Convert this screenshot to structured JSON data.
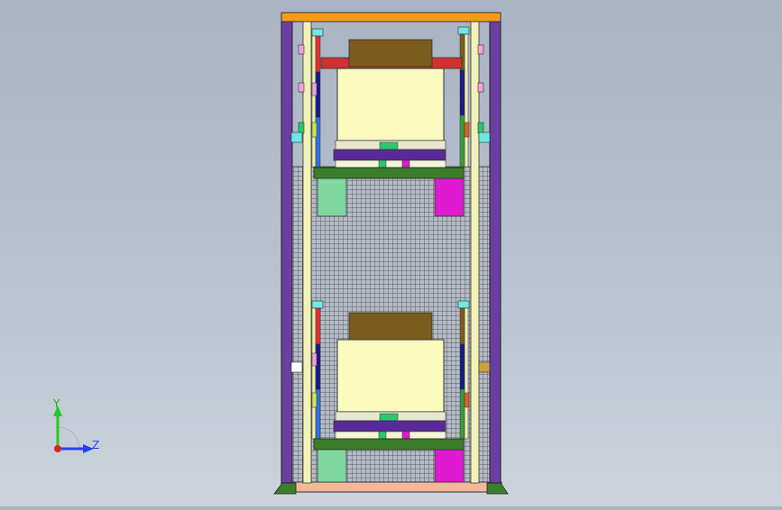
{
  "viewport": {
    "background_top": "#a9b3c2",
    "background_bottom": "#ccd3dc"
  },
  "triad": {
    "y_label": "Y",
    "z_label": "Z",
    "y_color": "#22cc22",
    "z_color": "#2244ee",
    "origin_color": "#dd2222"
  },
  "model": {
    "frame_color": "#6b3fa0",
    "top_beam_color": "#f59b1a",
    "base_color": "#f3b89a",
    "rail_color": "#f2f2b8",
    "mesh_color": "#6c6c6c",
    "box_color": "#fbfbc0",
    "lid_color": "#7a5c1c",
    "pallet_color": "#3c7d2c",
    "green_block_color": "#7fd8a0",
    "magenta_block_color": "#e01ad0"
  }
}
